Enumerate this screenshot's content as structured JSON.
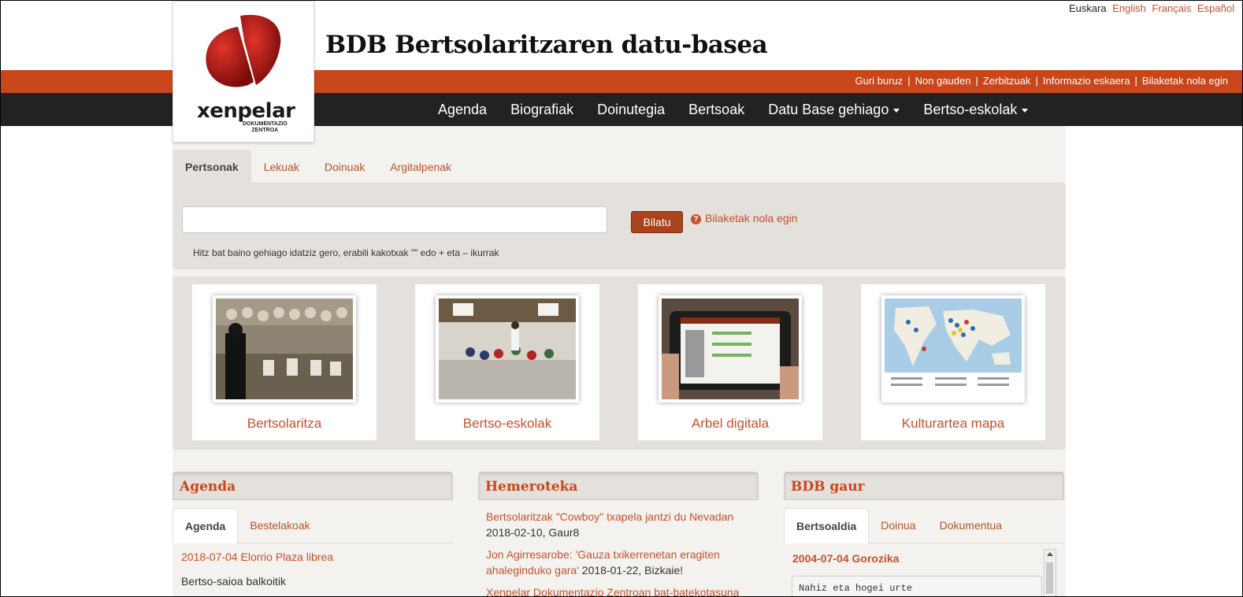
{
  "languages": {
    "current": "Euskara",
    "others": [
      "English",
      "Français",
      "Español"
    ]
  },
  "logo": {
    "name": "xenpelar",
    "sub1": "DOKUMENTAZIO",
    "sub2": "ZENTROA"
  },
  "site_title": "BDB Bertsolaritzaren datu-basea",
  "top_links": [
    "Guri buruz",
    "Non gauden",
    "Zerbitzuak",
    "Informazio eskaera",
    "Bilaketak nola egin"
  ],
  "nav": [
    "Agenda",
    "Biografiak",
    "Doinutegia",
    "Bertsoak",
    "Datu Base gehiago",
    "Bertso-eskolak"
  ],
  "search": {
    "tabs": [
      "Pertsonak",
      "Lekuak",
      "Doinuak",
      "Argitalpenak"
    ],
    "value": "",
    "button": "Bilatu",
    "help": "Bilaketak nola egin",
    "hint": "Hitz bat baino gehiago idatziz gero, erabili kakotxak \"\" edo + eta – ikurrak"
  },
  "cards": [
    "Bertsolaritza",
    "Bertso-eskolak",
    "Arbel digitala",
    "Kulturartea mapa"
  ],
  "agenda": {
    "title": "Agenda",
    "tabs": [
      "Agenda",
      "Bestelakoak"
    ],
    "items": [
      {
        "link": "2018-07-04 Elorrio Plaza librea",
        "text": "Bertso-saioa balkoitik"
      }
    ]
  },
  "hemeroteka": {
    "title": "Hemeroteka",
    "items": [
      {
        "link": "Bertsolaritzak \"Cowboy\" txapela jantzi du Nevadan",
        "meta": "2018-02-10, Gaur8"
      },
      {
        "link1": "Jon Agirresarobe: 'Gauza txikerrenetan eragiten",
        "link2": "ahaleginduko gara'",
        "meta": "2018-01-22, Bizkaie!"
      },
      {
        "link": "Xenpelar Dokumentazio Zentroan bat-batekotasuna"
      }
    ]
  },
  "bdbgaur": {
    "title": "BDB gaur",
    "tabs": [
      "Bertsoaldia",
      "Doinua",
      "Dokumentua"
    ],
    "heading": "2004-07-04 Gorozika",
    "verse": "Nahiz eta hogei urte"
  },
  "colors": {
    "brand_orange": "#c8461a",
    "nav_dark": "#222222",
    "link": "#c8502a",
    "button": "#a8431b"
  }
}
